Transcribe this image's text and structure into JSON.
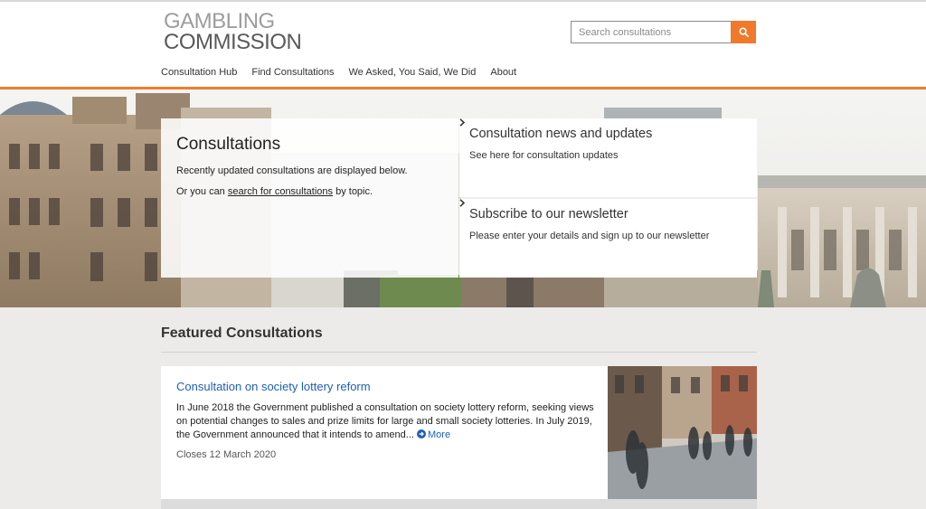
{
  "logo": {
    "line1": "GAMBLING",
    "line2": "COMMISSION"
  },
  "search": {
    "placeholder": "Search consultations",
    "button_icon": "search-icon"
  },
  "nav": {
    "items": [
      {
        "label": "Consultation Hub"
      },
      {
        "label": "Find Consultations"
      },
      {
        "label": "We Asked, You Said, We Did"
      },
      {
        "label": "About"
      }
    ]
  },
  "hero": {
    "title": "Consultations",
    "line1": "Recently updated consultations are displayed below.",
    "line2_prefix": "Or you can ",
    "line2_link": "search for consultations",
    "line2_suffix": " by topic."
  },
  "news": {
    "title": "Consultation news and updates",
    "link": "See here for consultation updates"
  },
  "newsletter": {
    "title": "Subscribe to our newsletter",
    "link": "Please enter your details and sign up to our newsletter"
  },
  "featured": {
    "heading": "Featured Consultations",
    "card": {
      "title": "Consultation on society lottery reform",
      "text": "In June 2018 the Government published a consultation on society lottery reform, seeking views on potential changes to sales and prize limits for large and small society lotteries. In July 2019, the Government announced that it intends to amend...",
      "more": "More",
      "closes": "Closes 12 March 2020"
    }
  },
  "colors": {
    "accent": "#ef7d2e",
    "link": "#1f5fb5",
    "background": "#ecebe9"
  }
}
